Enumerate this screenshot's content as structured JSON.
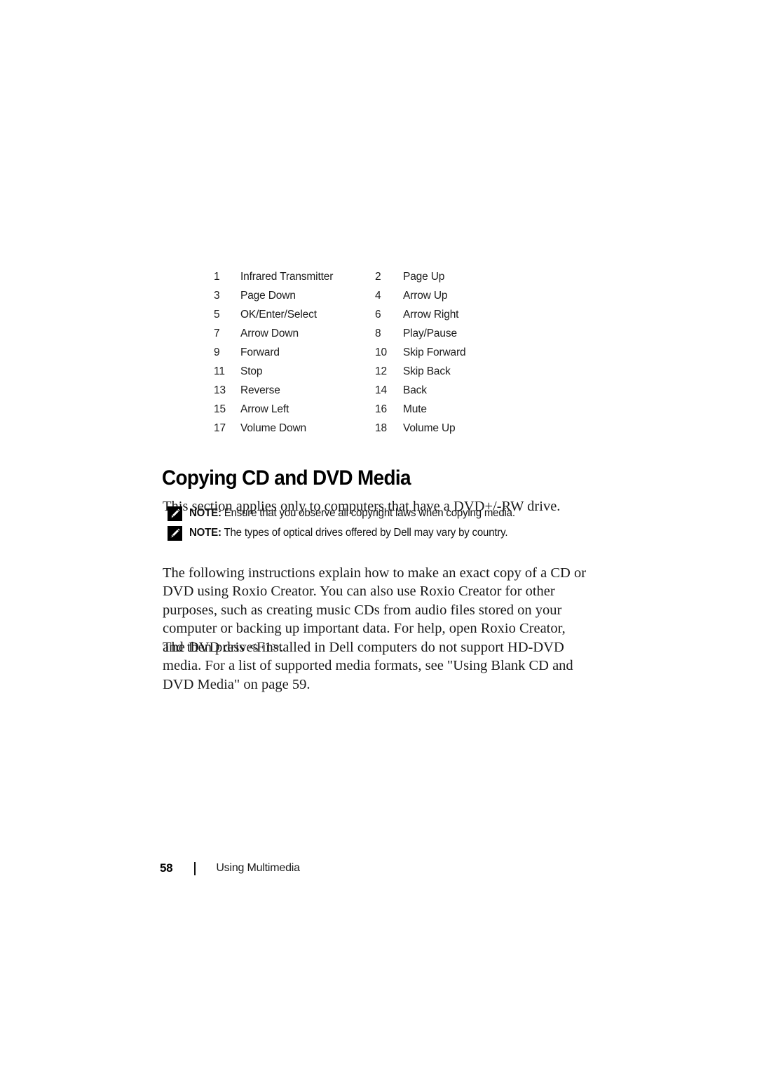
{
  "document": {
    "page_number": "58",
    "footer_section_title": "Using Multimedia",
    "footer_divider_glyph": "|"
  },
  "legend": {
    "rows": [
      {
        "num": "1",
        "label": "Infrared Transmitter",
        "num2": "2",
        "label2": "Page Up"
      },
      {
        "num": "3",
        "label": "Page Down",
        "num2": "4",
        "label2": "Arrow Up"
      },
      {
        "num": "5",
        "label": "OK/Enter/Select",
        "num2": "6",
        "label2": "Arrow Right"
      },
      {
        "num": "7",
        "label": "Arrow Down",
        "num2": "8",
        "label2": "Play/Pause"
      },
      {
        "num": "9",
        "label": "Forward",
        "num2": "10",
        "label2": "Skip Forward"
      },
      {
        "num": "11",
        "label": "Stop",
        "num2": "12",
        "label2": "Skip Back"
      },
      {
        "num": "13",
        "label": "Reverse",
        "num2": "14",
        "label2": "Back"
      },
      {
        "num": "15",
        "label": "Arrow Left",
        "num2": "16",
        "label2": "Mute"
      },
      {
        "num": "17",
        "label": "Volume Down",
        "num2": "18",
        "label2": "Volume Up"
      }
    ]
  },
  "section": {
    "heading": "Copying CD and DVD Media",
    "intro_paragraph": "This section applies only to computers that have a DVD+/-RW drive.",
    "roxio_paragraph": "The following instructions explain how to make an exact copy of a CD or DVD using Roxio Creator. You can also use Roxio Creator for other purposes, such as creating music CDs from audio files stored on your computer or backing up important data. For help, open Roxio Creator, and then press <F1>.",
    "dvd_paragraph": "The DVD drives installed in Dell computers do not support HD-DVD media. For a list of supported media formats, see \"Using Blank CD and DVD Media\" on page 59."
  },
  "notes": [
    {
      "keyword": "NOTE:",
      "text": " Ensure that you observe all copyright laws when copying media.",
      "icon": "note-pencil-icon"
    },
    {
      "keyword": "NOTE:",
      "text": " The types of optical drives offered by Dell may vary by country.",
      "icon": "note-pencil-icon"
    }
  ],
  "colors": {
    "page_background": "#ffffff",
    "body_text": "#1a1a1a",
    "heading_text": "#000000",
    "note_icon_background": "#000000",
    "note_icon_glyph": "#ffffff"
  }
}
